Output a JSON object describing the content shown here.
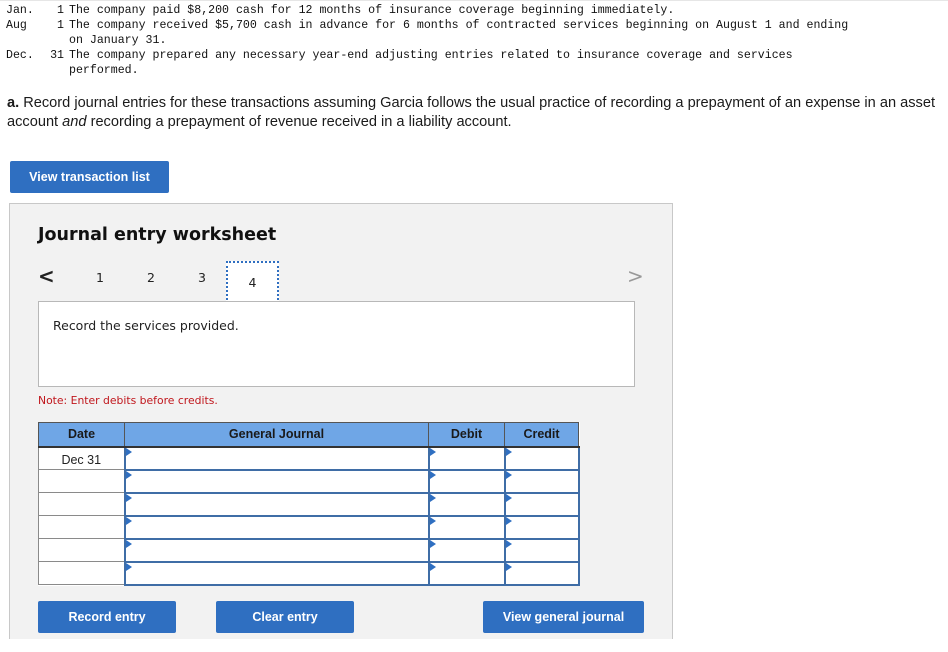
{
  "problem": {
    "lines": [
      {
        "month": "Jan.",
        "day": "1",
        "text": "The company paid $8,200 cash for 12 months of insurance coverage beginning immediately."
      },
      {
        "month": "Aug",
        "day": "1",
        "text": "The company received $5,700 cash in advance for 6 months of contracted services beginning on August 1 and ending"
      },
      {
        "month": "",
        "day": "",
        "text": "on January 31."
      },
      {
        "month": "Dec.",
        "day": "31",
        "text": "The company prepared any necessary year-end adjusting entries related to insurance coverage and services"
      },
      {
        "month": "",
        "day": "",
        "text": "performed."
      }
    ]
  },
  "instruction": {
    "label": "a.",
    "part1": " Record journal entries for these transactions assuming Garcia follows the usual practice of recording a prepayment of an expense in an asset account ",
    "emphasis": "and",
    "part2": " recording a prepayment of revenue received in a liability account."
  },
  "buttons": {
    "view_transaction_list": "View transaction list",
    "record_entry": "Record entry",
    "clear_entry": "Clear entry",
    "view_general_journal": "View general journal"
  },
  "worksheet": {
    "title": "Journal entry worksheet",
    "nav": {
      "prev": "<",
      "next": ">",
      "pages": [
        "1",
        "2",
        "3",
        "4"
      ],
      "active_page": "4"
    },
    "description": "Record the services provided.",
    "note": "Note: Enter debits before credits.",
    "table": {
      "headers": [
        "Date",
        "General Journal",
        "Debit",
        "Credit"
      ],
      "rows": [
        {
          "date": "Dec 31",
          "account": "",
          "debit": "",
          "credit": ""
        },
        {
          "date": "",
          "account": "",
          "debit": "",
          "credit": ""
        },
        {
          "date": "",
          "account": "",
          "debit": "",
          "credit": ""
        },
        {
          "date": "",
          "account": "",
          "debit": "",
          "credit": ""
        },
        {
          "date": "",
          "account": "",
          "debit": "",
          "credit": ""
        },
        {
          "date": "",
          "account": "",
          "debit": "",
          "credit": ""
        }
      ]
    }
  },
  "colors": {
    "accent": "#2f6fc1",
    "header_bg": "#6fa6e6",
    "note": "#c0161c",
    "panel_bg": "#f2f2f2"
  }
}
